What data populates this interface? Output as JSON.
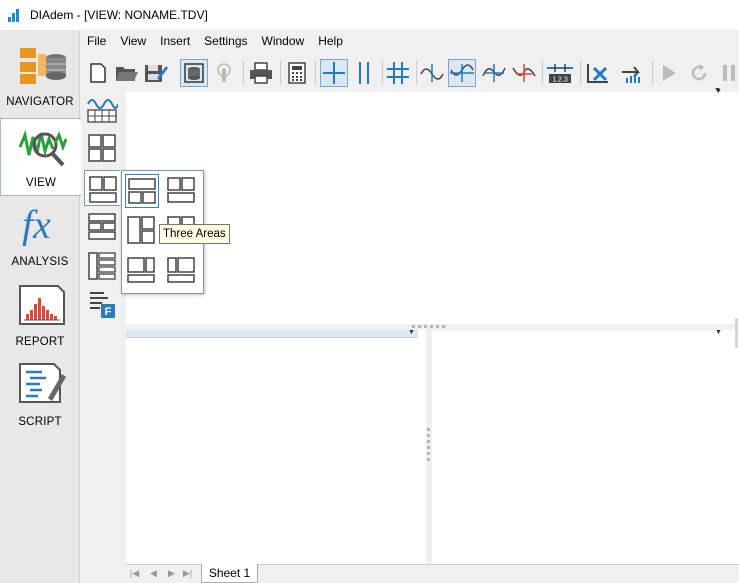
{
  "window": {
    "title": "DIAdem - [VIEW:  NONAME.TDV]"
  },
  "leftnav": {
    "items": [
      {
        "label": "NAVIGATOR",
        "icon": "navigator-icon",
        "active": false
      },
      {
        "label": "VIEW",
        "icon": "view-icon",
        "active": true
      },
      {
        "label": "ANALYSIS",
        "icon": "analysis-fx-icon",
        "active": false
      },
      {
        "label": "REPORT",
        "icon": "report-icon",
        "active": false
      },
      {
        "label": "SCRIPT",
        "icon": "script-icon",
        "active": false
      }
    ]
  },
  "menubar": {
    "items": [
      "File",
      "View",
      "Insert",
      "Settings",
      "Window",
      "Help"
    ]
  },
  "toolbar": {
    "icons": [
      "new-icon",
      "open-icon",
      "save-icon",
      "data-portal-icon",
      "touch-icon",
      "print-icon",
      "calculator-icon",
      "cursor-cross-icon",
      "two-cursors-icon",
      "band-cursor-icon",
      "peak-cursor-icon",
      "peak-cursor-selected-icon",
      "valley-cursor-icon",
      "cursor-measure-icon",
      "value-display-icon",
      "delete-points-icon",
      "export-icon",
      "play-icon",
      "repeat-icon",
      "pause-icon"
    ],
    "value_display_text": "1.2.3"
  },
  "tooltip": {
    "text": "Three Areas"
  },
  "sheets": {
    "tabs": [
      "Sheet 1"
    ]
  },
  "colors": {
    "accent": "#1e7ac8",
    "analysis": "#2a7bc0",
    "navigator_orange": "#e8961e",
    "view_green": "#2e9e3c",
    "selection_bg": "#d9e7f3"
  }
}
